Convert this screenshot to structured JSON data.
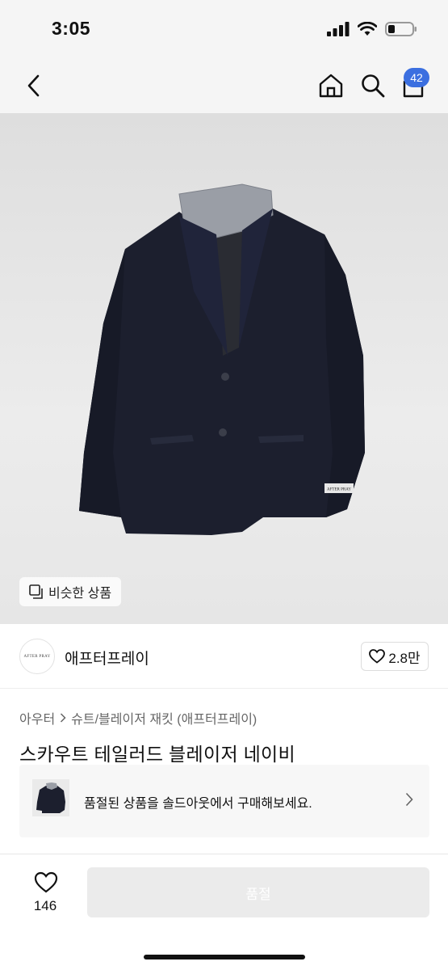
{
  "status": {
    "time": "3:05"
  },
  "header": {
    "cart_count": "42"
  },
  "image": {
    "similar_label": "비슷한 상품",
    "label_text": "AFTER PRAY"
  },
  "brand": {
    "logo_text": "AFTER PRAY",
    "name": "애프터프레이",
    "likes": "2.8만"
  },
  "breadcrumb": {
    "category": "아우터",
    "subcategory": "슈트/블레이저 재킷 (애프터프레이)"
  },
  "product": {
    "title": "스카우트 테일러드 블레이저 네이비"
  },
  "soldout_banner": {
    "text": "품절된 상품을 솔드아웃에서 구매해보세요."
  },
  "bottom": {
    "wish_count": "146",
    "buy_label": "품절"
  },
  "colors": {
    "badge": "#3b6fe0",
    "jacket": "#1c1f2e",
    "background": "#f5f5f5"
  },
  "icons": [
    "back-icon",
    "home-icon",
    "search-icon",
    "cart-icon",
    "heart-icon",
    "chevron-right-icon",
    "copy-icon"
  ]
}
